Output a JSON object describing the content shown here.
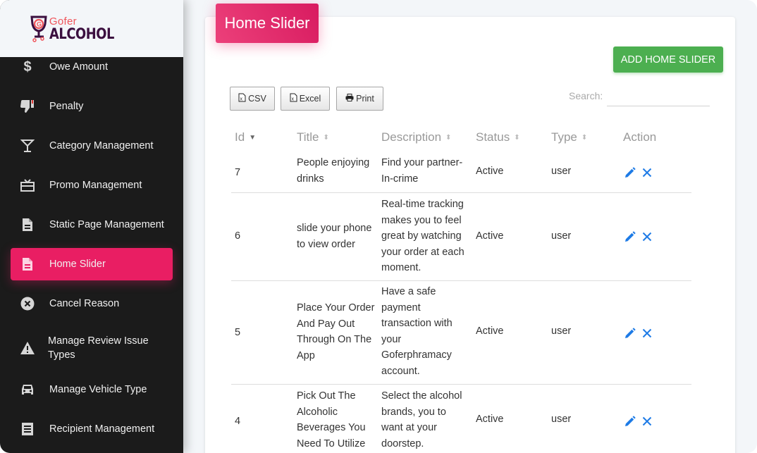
{
  "brand": {
    "logo_top": "Gofer",
    "logo_bottom": "ALCOHOL",
    "primary_color": "#e91e63",
    "success_color": "#4caf50",
    "action_color": "#1e7be6"
  },
  "sidebar": {
    "items": [
      {
        "label": "Owe Amount",
        "icon": "dollar-icon",
        "active": false
      },
      {
        "label": "Penalty",
        "icon": "thumbs-down-icon",
        "active": false
      },
      {
        "label": "Category Management",
        "icon": "cocktail-glass-icon",
        "active": false
      },
      {
        "label": "Promo Management",
        "icon": "gift-card-icon",
        "active": false
      },
      {
        "label": "Static Page Management",
        "icon": "document-icon",
        "active": false
      },
      {
        "label": "Home Slider",
        "icon": "document-icon",
        "active": true
      },
      {
        "label": "Cancel Reason",
        "icon": "cancel-circle-icon",
        "active": false
      },
      {
        "label": "Manage Review Issue Types",
        "icon": "warning-icon",
        "active": false
      },
      {
        "label": "Manage Vehicle Type",
        "icon": "car-icon",
        "active": false
      },
      {
        "label": "Recipient Management",
        "icon": "receipt-icon",
        "active": false
      }
    ]
  },
  "page": {
    "title": "Home Slider",
    "add_button": "ADD HOME SLIDER",
    "export_buttons": [
      {
        "label": "CSV",
        "icon": "file-excel-icon"
      },
      {
        "label": "Excel",
        "icon": "file-excel-icon"
      },
      {
        "label": "Print",
        "icon": "print-icon"
      }
    ],
    "search": {
      "label": "Search:",
      "value": "",
      "placeholder": ""
    }
  },
  "table": {
    "columns": [
      {
        "label": "Id",
        "sort": "desc"
      },
      {
        "label": "Title",
        "sort": "both"
      },
      {
        "label": "Description",
        "sort": "both"
      },
      {
        "label": "Status",
        "sort": "both"
      },
      {
        "label": "Type",
        "sort": "both"
      },
      {
        "label": "Action",
        "sort": "none"
      }
    ],
    "rows": [
      {
        "id": "7",
        "title": "People enjoying drinks",
        "description": "Find your partner-In-crime",
        "status": "Active",
        "type": "user"
      },
      {
        "id": "6",
        "title": "slide your phone to view order",
        "description": "Real-time tracking makes you to feel great by watching your order at each moment.",
        "status": "Active",
        "type": "user"
      },
      {
        "id": "5",
        "title": "Place Your Order And Pay Out Through On The App",
        "description": "Have a safe payment transaction with your Goferphramacy account.",
        "status": "Active",
        "type": "user"
      },
      {
        "id": "4",
        "title": "Pick Out The Alcoholic Beverages You Need To Utilize",
        "description": "Select the alcohol brands, you to want at your doorstep.",
        "status": "Active",
        "type": "user"
      }
    ]
  }
}
